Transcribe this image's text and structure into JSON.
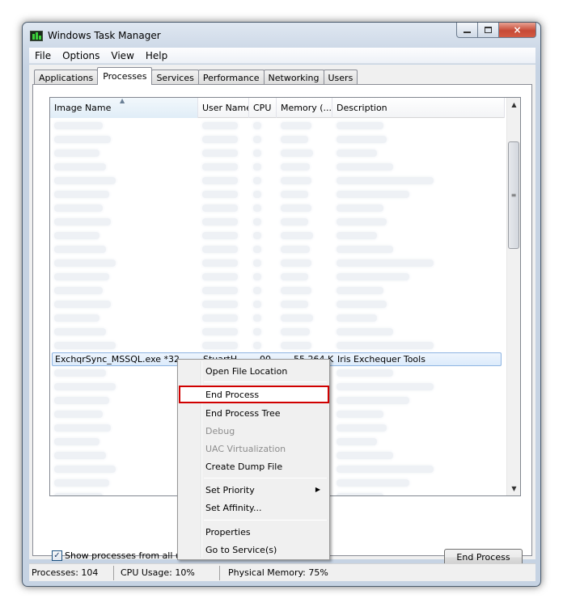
{
  "window": {
    "title": "Windows Task Manager",
    "close_glyph": "×"
  },
  "menu": [
    "File",
    "Options",
    "View",
    "Help"
  ],
  "tabs": [
    "Applications",
    "Processes",
    "Services",
    "Performance",
    "Networking",
    "Users"
  ],
  "active_tab": "Processes",
  "columns": [
    "Image Name",
    "User Name",
    "CPU",
    "Memory (...",
    "Description"
  ],
  "sort_glyph": "▲",
  "selected_process": {
    "image_name": "ExchqrSync_MSSQL.exe *32",
    "user_name": "StuartH",
    "cpu": "00",
    "memory": "55,264 K",
    "description": "Iris Exchequer Tools"
  },
  "context_menu": {
    "items": [
      {
        "label": "Open File Location",
        "enabled": true
      },
      {
        "label": "End Process",
        "enabled": true,
        "highlighted": true
      },
      {
        "label": "End Process Tree",
        "enabled": true
      },
      {
        "label": "Debug",
        "enabled": false
      },
      {
        "label": "UAC Virtualization",
        "enabled": false
      },
      {
        "label": "Create Dump File",
        "enabled": true
      },
      {
        "label": "Set Priority",
        "enabled": true,
        "submenu": true
      },
      {
        "label": "Set Affinity...",
        "enabled": true
      },
      {
        "label": "Properties",
        "enabled": true
      },
      {
        "label": "Go to Service(s)",
        "enabled": true
      }
    ],
    "submenu_glyph": "▶"
  },
  "show_all_users": {
    "label": "Show processes from all users",
    "checked": true,
    "check_glyph": "✓"
  },
  "end_process_button": "End Process",
  "scrollbar": {
    "up_glyph": "▲",
    "down_glyph": "▼",
    "grip_glyph": "≡"
  },
  "status": {
    "processes": "Processes: 104",
    "cpu_usage": "CPU Usage: 10%",
    "physical_memory": "Physical Memory: 75%"
  },
  "colors": {
    "highlight_border": "#d00000",
    "selection_border": "#8eb4e2"
  }
}
